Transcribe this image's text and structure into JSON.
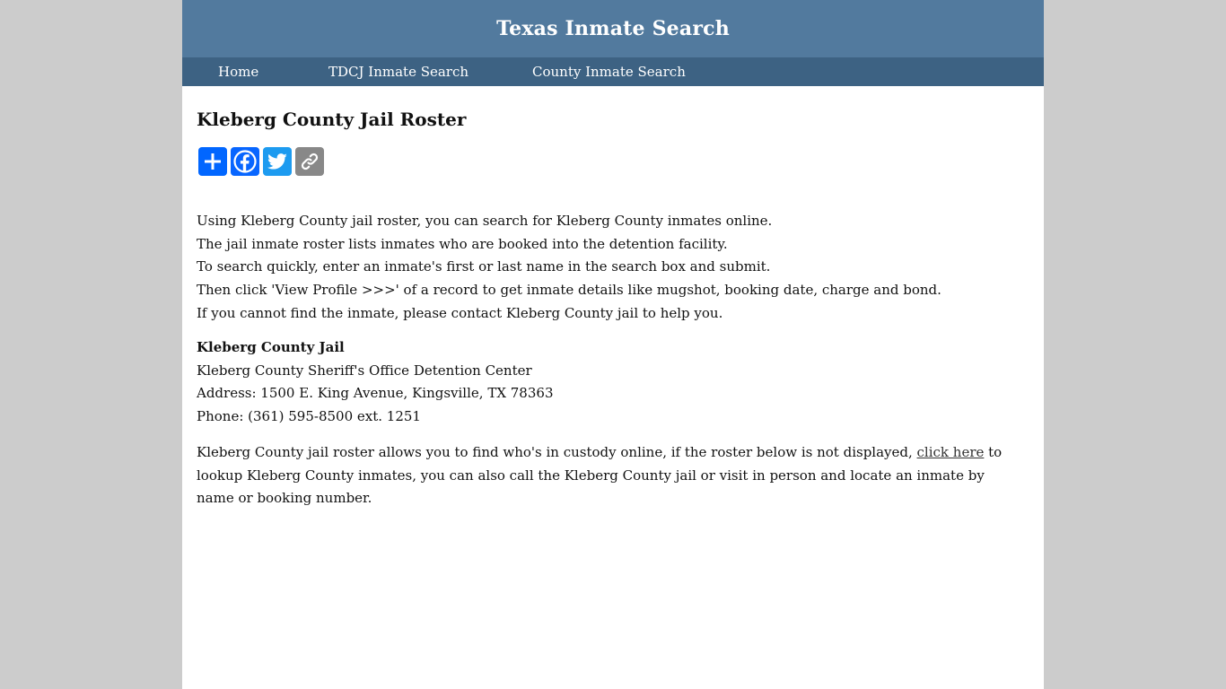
{
  "header": {
    "site_title": "Texas Inmate Search"
  },
  "nav": {
    "items": [
      {
        "label": "Home"
      },
      {
        "label": "TDCJ Inmate Search"
      },
      {
        "label": "County Inmate Search"
      }
    ]
  },
  "main": {
    "title": "Kleberg County Jail Roster",
    "share_buttons": [
      {
        "icon": "plus-icon",
        "color": "#0166ff"
      },
      {
        "icon": "facebook-icon",
        "color": "#0866ff"
      },
      {
        "icon": "twitter-icon",
        "color": "#1d9bf0"
      },
      {
        "icon": "link-icon",
        "color": "#888888"
      }
    ],
    "intro_lines": [
      "Using Kleberg County jail roster, you can search for Kleberg County inmates online.",
      "The jail inmate roster lists inmates who are booked into the detention facility.",
      "To search quickly, enter an inmate's first or last name in the search box and submit.",
      "Then click 'View Profile >>>' of a record to get inmate details like mugshot, booking date, charge and bond.",
      "If you cannot find the inmate, please contact Kleberg County jail to help you."
    ],
    "jail": {
      "name": "Kleberg County Jail",
      "facility": "Kleberg County Sheriff's Office Detention Center",
      "address": "Address: 1500 E. King Avenue, Kingsville, TX 78363",
      "phone": "Phone: (361) 595-8500 ext. 1251"
    },
    "roster_paragraph": {
      "before_link": "Kleberg County jail roster allows you to find who's in custody online, if the roster below is not displayed, ",
      "link_text": "click here",
      "after_link": " to lookup Kleberg County inmates, you can also call the Kleberg County jail or visit in person and locate an inmate by name or booking number."
    }
  },
  "colors": {
    "header_bg": "#527a9e",
    "nav_bg": "#3d6283",
    "page_bg": "#cccccc"
  }
}
